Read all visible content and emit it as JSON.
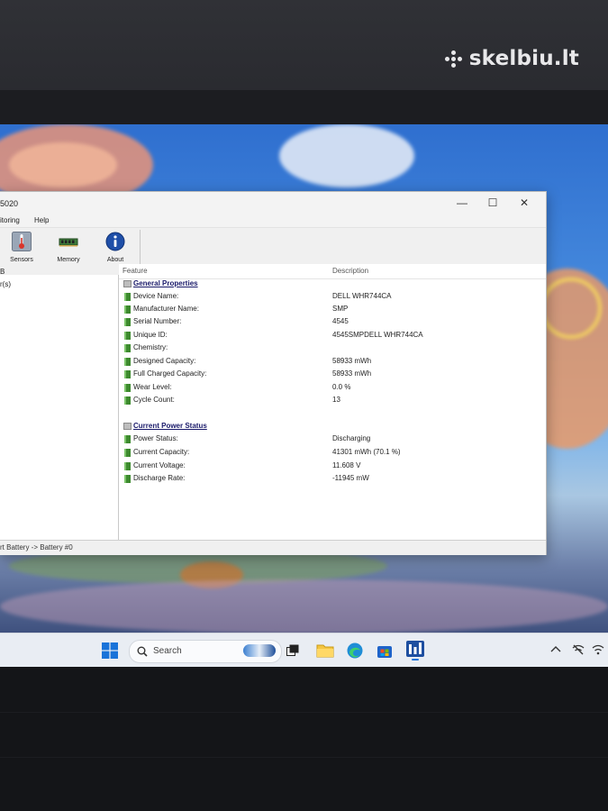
{
  "watermark": {
    "text": "skelbiu.lt"
  },
  "window": {
    "title_fragment": "5020",
    "controls": {
      "minimize": "—",
      "maximize": "☐",
      "close": "✕"
    },
    "menu": {
      "monitoring": "itoring",
      "help": "Help"
    },
    "toolbar": {
      "sensors": "Sensors",
      "memory": "Memory",
      "about": "About"
    },
    "left_pane": {
      "line1": "B",
      "line2": "r(s)"
    },
    "columns": {
      "feature": "Feature",
      "description": "Description"
    },
    "general_properties": {
      "header": "General Properties",
      "rows": [
        {
          "feature": "Device Name:",
          "value": "DELL WHR744CA"
        },
        {
          "feature": "Manufacturer Name:",
          "value": "SMP"
        },
        {
          "feature": "Serial Number:",
          "value": "4545"
        },
        {
          "feature": "Unique ID:",
          "value": "4545SMPDELL WHR744CA"
        },
        {
          "feature": "Chemistry:",
          "value": ""
        },
        {
          "feature": "Designed Capacity:",
          "value": "58933 mWh"
        },
        {
          "feature": "Full Charged Capacity:",
          "value": "58933 mWh"
        },
        {
          "feature": "Wear Level:",
          "value": "0.0 %"
        },
        {
          "feature": "Cycle Count:",
          "value": "13"
        }
      ]
    },
    "current_power_status": {
      "header": "Current Power Status",
      "rows": [
        {
          "feature": "Power Status:",
          "value": "Discharging"
        },
        {
          "feature": "Current Capacity:",
          "value": "41301 mWh (70.1 %)"
        },
        {
          "feature": "Current Voltage:",
          "value": "11.608 V"
        },
        {
          "feature": "Discharge Rate:",
          "value": "-11945 mW"
        }
      ]
    },
    "status_bar": "rt Battery -> Battery #0"
  },
  "taskbar": {
    "search_label": "Search",
    "icons": [
      "windows-start-icon",
      "search-icon",
      "task-view-icon",
      "file-explorer-icon",
      "edge-browser-icon",
      "store-icon",
      "hwinfo-app-icon"
    ],
    "tray_icons": [
      "chevron-up-icon",
      "network-off-icon",
      "wifi-icon"
    ]
  },
  "colors": {
    "accent_green": "#3d8a2e",
    "header_text": "#1a1a6a",
    "taskbar": "#e9edf3"
  }
}
